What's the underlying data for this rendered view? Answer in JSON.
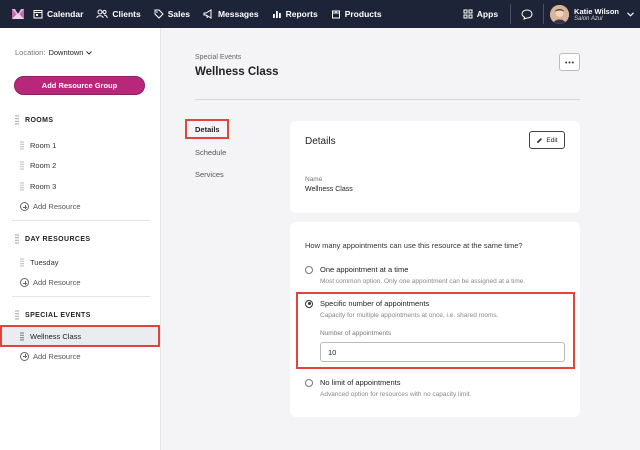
{
  "nav": {
    "items": [
      {
        "label": "Calendar",
        "icon": "calendar-icon"
      },
      {
        "label": "Clients",
        "icon": "clients-icon"
      },
      {
        "label": "Sales",
        "icon": "tag-icon"
      },
      {
        "label": "Messages",
        "icon": "megaphone-icon"
      },
      {
        "label": "Reports",
        "icon": "bar-chart-icon"
      },
      {
        "label": "Products",
        "icon": "package-icon"
      }
    ],
    "apps_label": "Apps",
    "user_name": "Katie Wilson",
    "user_salon": "Salon Azul"
  },
  "sidebar": {
    "location_label": "Location:",
    "location_value": "Downtown",
    "add_group_label": "Add Resource Group",
    "add_resource_label": "Add Resource",
    "sections": [
      {
        "title": "ROOMS",
        "items": [
          "Room 1",
          "Room 2",
          "Room 3"
        ]
      },
      {
        "title": "DAY RESOURCES",
        "items": [
          "Tuesday"
        ]
      },
      {
        "title": "SPECIAL EVENTS",
        "items": [
          "Wellness Class"
        ]
      }
    ]
  },
  "header": {
    "breadcrumb": "Special Events",
    "title": "Wellness Class"
  },
  "subnav": {
    "active": "Details",
    "items": [
      "Schedule",
      "Services"
    ]
  },
  "details_card": {
    "title": "Details",
    "edit_label": "Edit",
    "name_label": "Name",
    "name_value": "Wellness Class"
  },
  "capacity_card": {
    "question": "How many appointments can use this resource at the same time?",
    "options": [
      {
        "title": "One appointment at a time",
        "desc": "Most common option. Only one appointment can be assigned at a time.",
        "selected": false
      },
      {
        "title": "Specific number of appointments",
        "desc": "Capacity for multiple appointments at once, i.e. shared rooms.",
        "selected": true
      },
      {
        "title": "No limit of appointments",
        "desc": "Advanced option for resources with no capacity limit.",
        "selected": false
      }
    ],
    "number_label": "Number of appointments",
    "number_value": "10"
  },
  "colors": {
    "nav_bg": "#1e2437",
    "accent": "#b8277a",
    "highlight": "#e0443a"
  }
}
